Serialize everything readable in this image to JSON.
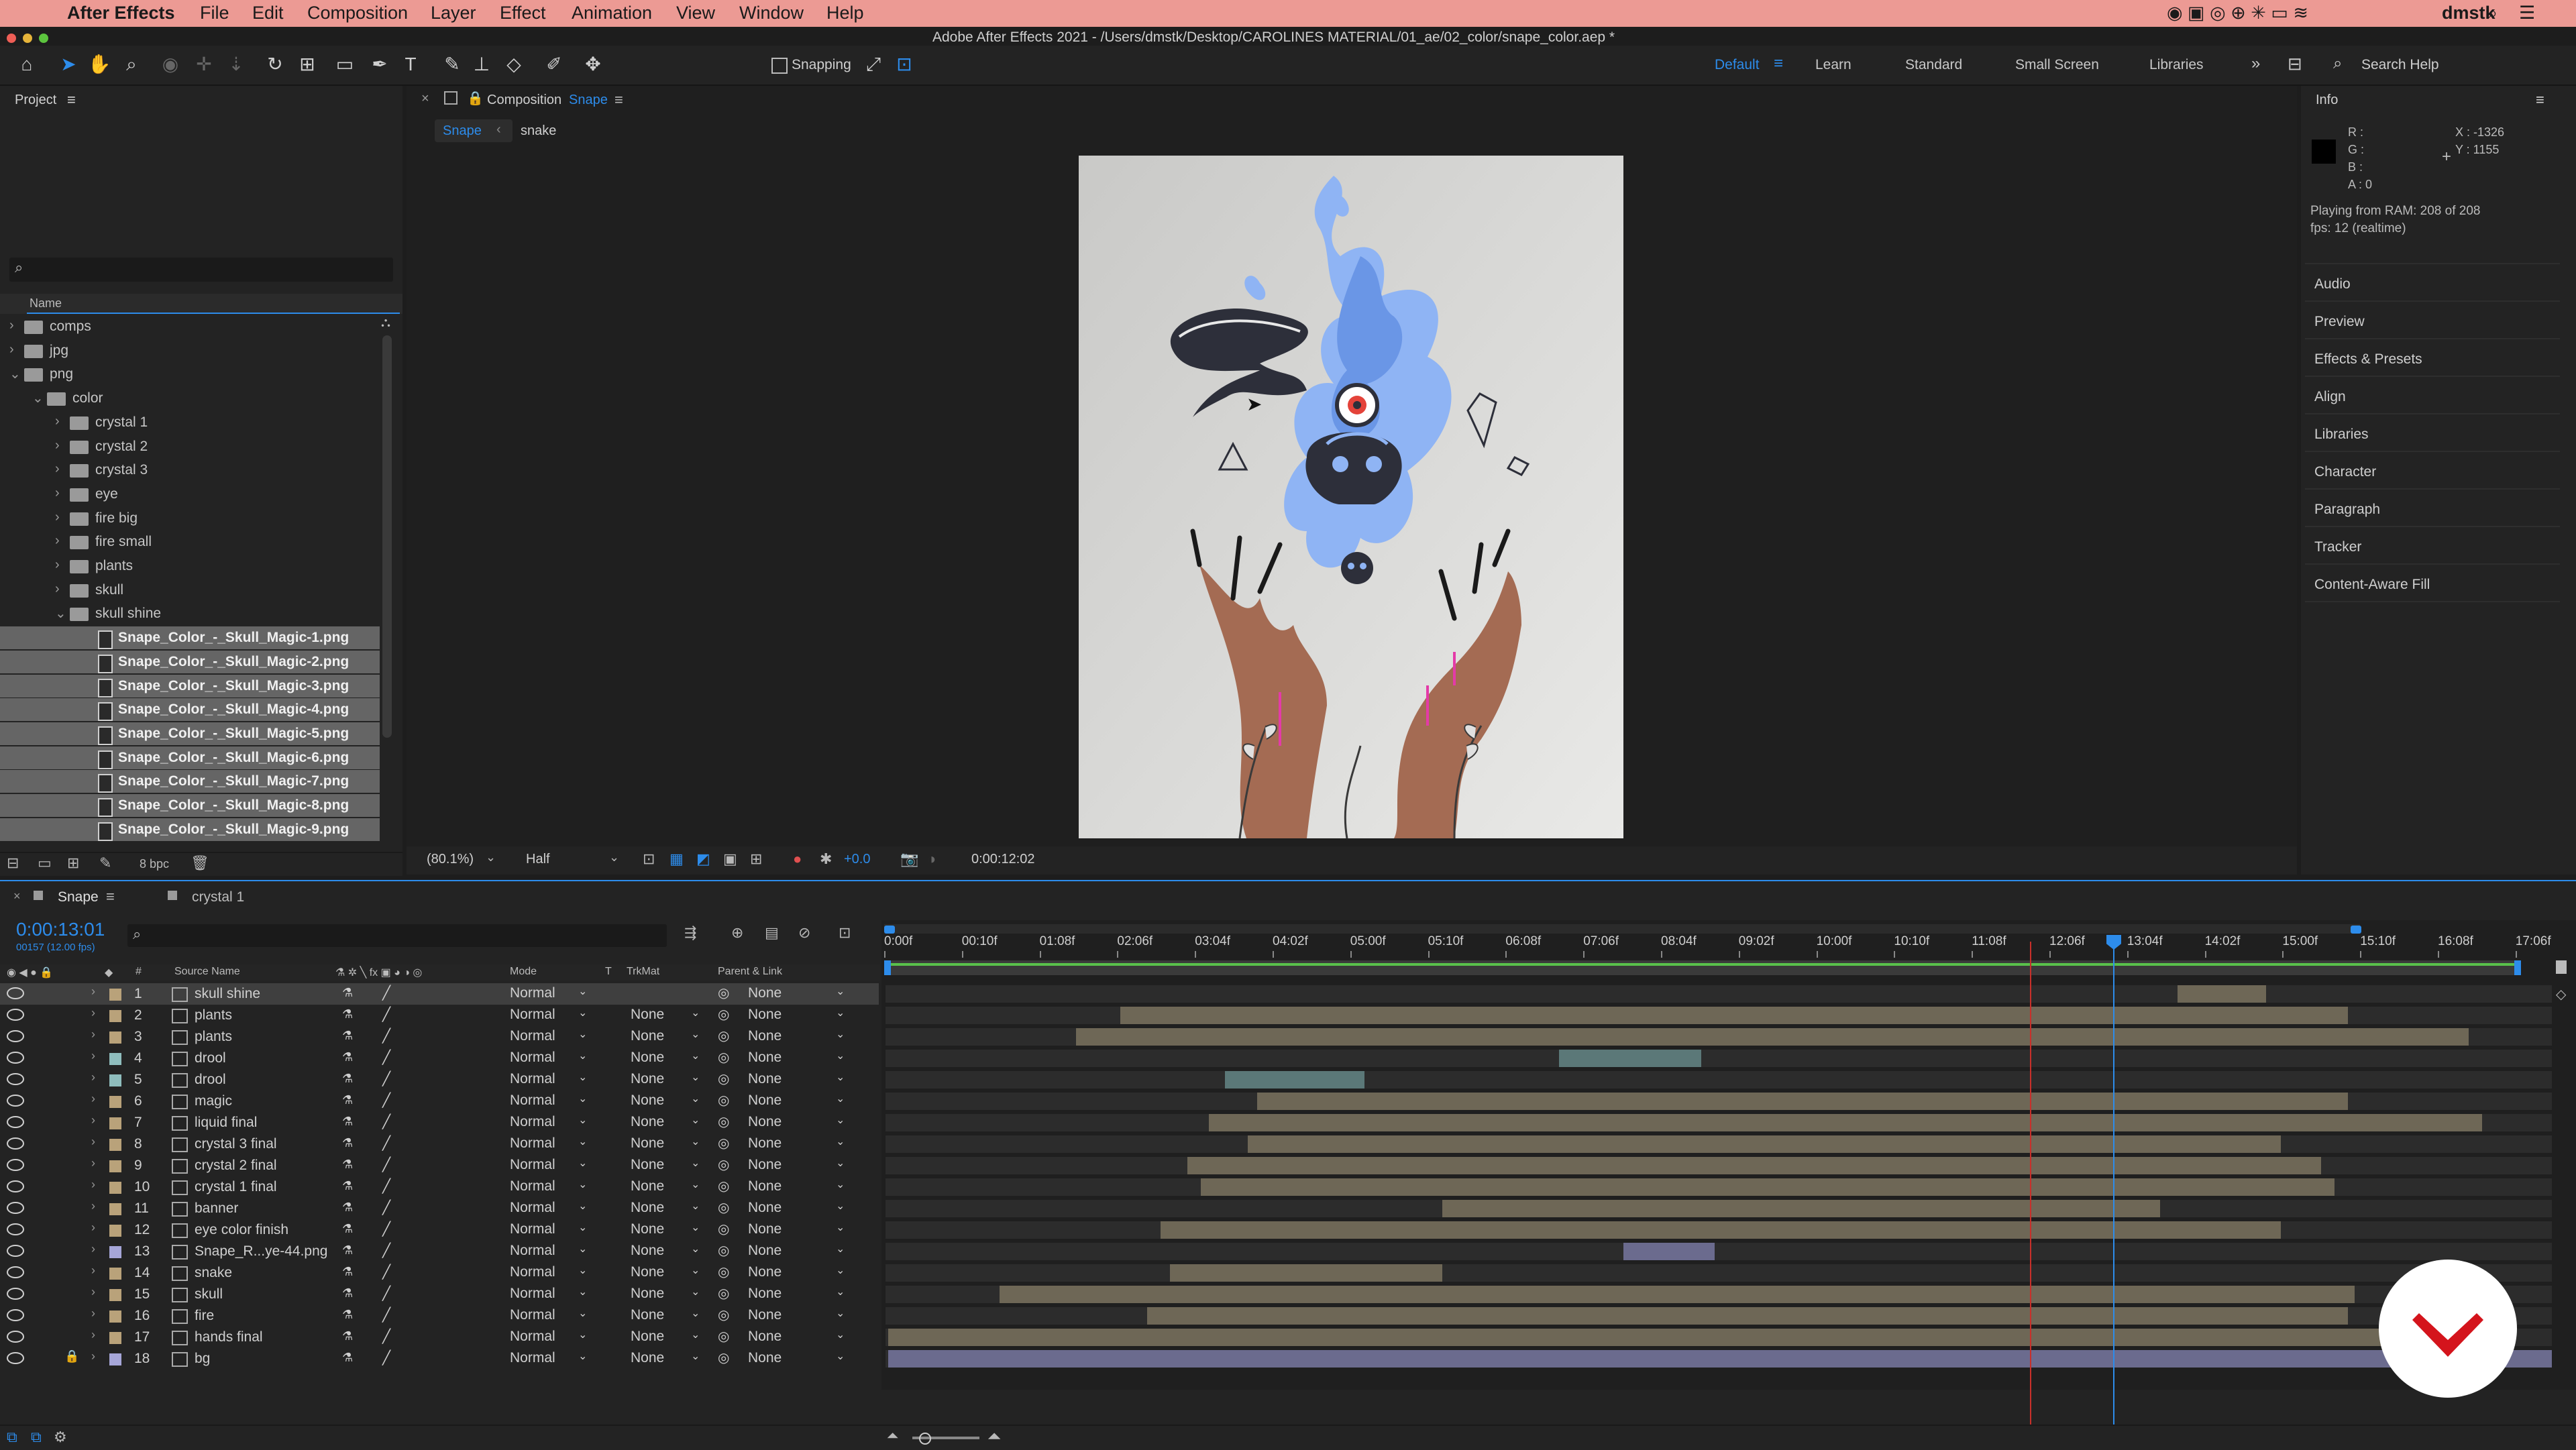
{
  "menubar": {
    "app": "After Effects",
    "items": [
      "File",
      "Edit",
      "Composition",
      "Layer",
      "Effect",
      "Animation",
      "View",
      "Window",
      "Help"
    ],
    "title": "Adobe After Effects 2021 - /Users/dmstk/Desktop/CAROLINES MATERIAL/01_ae/02_color/snape_color.aep *",
    "user": "dmstk"
  },
  "toolbar": {
    "snapping_label": "Snapping",
    "workspaces": [
      "Default",
      "Learn",
      "Standard",
      "Small Screen",
      "Libraries"
    ],
    "search_placeholder": "Search Help"
  },
  "project": {
    "title": "Project",
    "column_name": "Name",
    "rows": [
      {
        "label": "comps",
        "type": "folder",
        "depth": 0,
        "expanded": false
      },
      {
        "label": "jpg",
        "type": "folder",
        "depth": 0,
        "expanded": false
      },
      {
        "label": "png",
        "type": "folder",
        "depth": 0,
        "expanded": true
      },
      {
        "label": "color",
        "type": "folder",
        "depth": 1,
        "expanded": true
      },
      {
        "label": "crystal 1",
        "type": "folder",
        "depth": 2,
        "expanded": false
      },
      {
        "label": "crystal 2",
        "type": "folder",
        "depth": 2,
        "expanded": false
      },
      {
        "label": "crystal 3",
        "type": "folder",
        "depth": 2,
        "expanded": false
      },
      {
        "label": "eye",
        "type": "folder",
        "depth": 2,
        "expanded": false
      },
      {
        "label": "fire big",
        "type": "folder",
        "depth": 2,
        "expanded": false
      },
      {
        "label": "fire small",
        "type": "folder",
        "depth": 2,
        "expanded": false
      },
      {
        "label": "plants",
        "type": "folder",
        "depth": 2,
        "expanded": false
      },
      {
        "label": "skull",
        "type": "folder",
        "depth": 2,
        "expanded": false
      },
      {
        "label": "skull shine",
        "type": "folder",
        "depth": 2,
        "expanded": true
      },
      {
        "label": "Snape_Color_-_Skull_Magic-1.png",
        "type": "file",
        "depth": 3,
        "selected": true
      },
      {
        "label": "Snape_Color_-_Skull_Magic-2.png",
        "type": "file",
        "depth": 3,
        "selected": true
      },
      {
        "label": "Snape_Color_-_Skull_Magic-3.png",
        "type": "file",
        "depth": 3,
        "selected": true
      },
      {
        "label": "Snape_Color_-_Skull_Magic-4.png",
        "type": "file",
        "depth": 3,
        "selected": true
      },
      {
        "label": "Snape_Color_-_Skull_Magic-5.png",
        "type": "file",
        "depth": 3,
        "selected": true
      },
      {
        "label": "Snape_Color_-_Skull_Magic-6.png",
        "type": "file",
        "depth": 3,
        "selected": true
      },
      {
        "label": "Snape_Color_-_Skull_Magic-7.png",
        "type": "file",
        "depth": 3,
        "selected": true
      },
      {
        "label": "Snape_Color_-_Skull_Magic-8.png",
        "type": "file",
        "depth": 3,
        "selected": true
      },
      {
        "label": "Snape_Color_-_Skull_Magic-9.png",
        "type": "file",
        "depth": 3,
        "selected": true
      }
    ],
    "bpc": "8 bpc"
  },
  "composition": {
    "panel_label": "Composition",
    "comp_name": "Snape",
    "breadcrumbs": [
      "Snape",
      "snake"
    ],
    "zoom": "(80.1%)",
    "resolution": "Half",
    "exposure": "+0.0",
    "time": "0:00:12:02"
  },
  "info": {
    "title": "Info",
    "r": "R :",
    "g": "G :",
    "b": "B :",
    "a": "A : 0",
    "x": "X : -1326",
    "y": "Y : 1155",
    "status1": "Playing from RAM: 208 of 208",
    "status2": "fps: 12 (realtime)"
  },
  "right_panels": [
    "Audio",
    "Preview",
    "Effects & Presets",
    "Align",
    "Libraries",
    "Character",
    "Paragraph",
    "Tracker",
    "Content-Aware Fill"
  ],
  "timeline": {
    "tabs": [
      "Snape",
      "crystal 1"
    ],
    "timecode": "0:00:13:01",
    "frames": "00157 (12.00 fps)",
    "col_source": "Source Name",
    "col_mode": "Mode",
    "col_t": "T",
    "col_trkmat": "TrkMat",
    "col_parent": "Parent & Link",
    "col_hash": "#",
    "ruler": [
      "0:00f",
      "00:10f",
      "01:08f",
      "02:06f",
      "03:04f",
      "04:02f",
      "05:00f",
      "05:10f",
      "06:08f",
      "07:06f",
      "08:04f",
      "09:02f",
      "10:00f",
      "10:10f",
      "11:08f",
      "12:06f",
      "13:04f",
      "14:02f",
      "15:00f",
      "15:10f",
      "16:08f",
      "17:06f"
    ],
    "layers": [
      {
        "n": "1",
        "name": "skull shine",
        "mode": "Normal",
        "trk": "",
        "parent": "None",
        "color": "#b9a27a",
        "selected": true
      },
      {
        "n": "2",
        "name": "plants",
        "mode": "Normal",
        "trk": "None",
        "parent": "None",
        "color": "#b9a27a"
      },
      {
        "n": "3",
        "name": "plants",
        "mode": "Normal",
        "trk": "None",
        "parent": "None",
        "color": "#b9a27a"
      },
      {
        "n": "4",
        "name": "drool",
        "mode": "Normal",
        "trk": "None",
        "parent": "None",
        "color": "#8fbdbd"
      },
      {
        "n": "5",
        "name": "drool",
        "mode": "Normal",
        "trk": "None",
        "parent": "None",
        "color": "#8fbdbd"
      },
      {
        "n": "6",
        "name": "magic",
        "mode": "Normal",
        "trk": "None",
        "parent": "None",
        "color": "#b9a27a"
      },
      {
        "n": "7",
        "name": "liquid final",
        "mode": "Normal",
        "trk": "None",
        "parent": "None",
        "color": "#b9a27a"
      },
      {
        "n": "8",
        "name": "crystal 3 final",
        "mode": "Normal",
        "trk": "None",
        "parent": "None",
        "color": "#b9a27a"
      },
      {
        "n": "9",
        "name": "crystal 2 final",
        "mode": "Normal",
        "trk": "None",
        "parent": "None",
        "color": "#b9a27a"
      },
      {
        "n": "10",
        "name": "crystal 1 final",
        "mode": "Normal",
        "trk": "None",
        "parent": "None",
        "color": "#b9a27a"
      },
      {
        "n": "11",
        "name": "banner",
        "mode": "Normal",
        "trk": "None",
        "parent": "None",
        "color": "#b9a27a"
      },
      {
        "n": "12",
        "name": "eye color finish",
        "mode": "Normal",
        "trk": "None",
        "parent": "None",
        "color": "#b9a27a"
      },
      {
        "n": "13",
        "name": "Snape_R...ye-44.png",
        "mode": "Normal",
        "trk": "None",
        "parent": "None",
        "color": "#a6a6d8"
      },
      {
        "n": "14",
        "name": "snake",
        "mode": "Normal",
        "trk": "None",
        "parent": "None",
        "color": "#b9a27a"
      },
      {
        "n": "15",
        "name": "skull",
        "mode": "Normal",
        "trk": "None",
        "parent": "None",
        "color": "#b9a27a"
      },
      {
        "n": "16",
        "name": "fire",
        "mode": "Normal",
        "trk": "None",
        "parent": "None",
        "color": "#b9a27a"
      },
      {
        "n": "17",
        "name": "hands final",
        "mode": "Normal",
        "trk": "None",
        "parent": "None",
        "color": "#b9a27a"
      },
      {
        "n": "18",
        "name": "bg",
        "mode": "Normal",
        "trk": "None",
        "parent": "None",
        "color": "#a6a6d8"
      }
    ]
  },
  "colors": {
    "accent": "#2d8ceb",
    "menubar": "#ec9a94",
    "panel": "#232323",
    "bar_tan": "#6e6756",
    "bar_teal": "#5b7878",
    "bar_purple": "#6b6b8e",
    "logo_red": "#d4141c"
  }
}
